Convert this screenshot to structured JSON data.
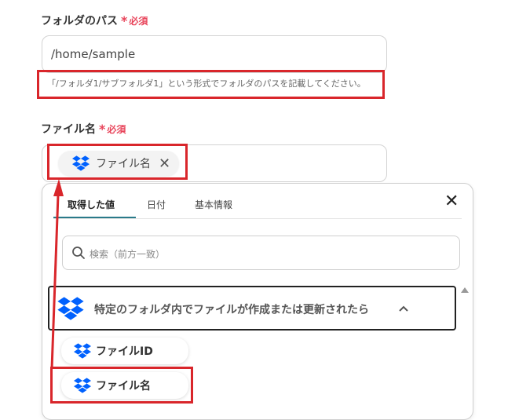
{
  "folder_path": {
    "label": "フォルダのパス",
    "required_mark": "*",
    "required_text": "必須",
    "value": "/home/sample",
    "hint": "「/フォルダ1/サブフォルダ1」という形式でフォルダのパスを記載してください。"
  },
  "file_name": {
    "label": "ファイル名",
    "required_mark": "*",
    "required_text": "必須",
    "chip_label": "ファイル名",
    "chip_close": "✕"
  },
  "picker": {
    "tabs": [
      {
        "label": "取得した値"
      },
      {
        "label": "日付"
      },
      {
        "label": "基本情報"
      }
    ],
    "close": "✕",
    "search_placeholder": "検索（前方一致）",
    "trigger_label": "特定のフォルダ内でファイルが作成または更新されたら",
    "items": [
      {
        "label": "ファイルID"
      },
      {
        "label": "ファイル名"
      }
    ]
  },
  "colors": {
    "required": "#e8445a",
    "highlight": "#d9262b",
    "dropbox": "#0061fe",
    "tab_accent": "#2a7a8a"
  }
}
